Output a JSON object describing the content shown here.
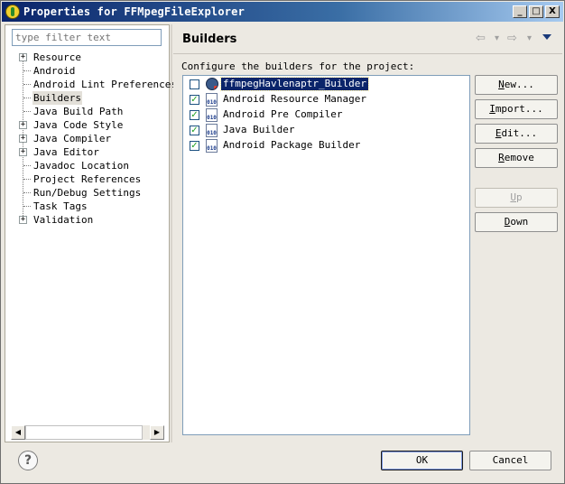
{
  "window": {
    "title": "Properties for FFMpegFileExplorer",
    "controls": {
      "minimize": "_",
      "maximize": "□",
      "close": "X"
    }
  },
  "sidebar": {
    "filter_placeholder": "type filter text",
    "items": [
      {
        "label": "Resource",
        "expandable": true
      },
      {
        "label": "Android",
        "expandable": false
      },
      {
        "label": "Android Lint Preferences",
        "expandable": false
      },
      {
        "label": "Builders",
        "expandable": false,
        "selected": true
      },
      {
        "label": "Java Build Path",
        "expandable": false
      },
      {
        "label": "Java Code Style",
        "expandable": true
      },
      {
        "label": "Java Compiler",
        "expandable": true
      },
      {
        "label": "Java Editor",
        "expandable": true
      },
      {
        "label": "Javadoc Location",
        "expandable": false
      },
      {
        "label": "Project References",
        "expandable": false
      },
      {
        "label": "Run/Debug Settings",
        "expandable": false
      },
      {
        "label": "Task Tags",
        "expandable": false
      },
      {
        "label": "Validation",
        "expandable": true
      }
    ],
    "scroll_left": "◀",
    "scroll_right": "▶"
  },
  "page": {
    "title": "Builders",
    "nav": {
      "back": "⇦",
      "back_menu": "▾",
      "forward": "⇨",
      "forward_menu": "▾"
    },
    "description": "Configure the builders for the project:",
    "builders": [
      {
        "label": "ffmpegHavlenaptr_Builder",
        "checked": false,
        "selected": true,
        "icon": "external-tool-icon",
        "icon_text": ""
      },
      {
        "label": "Android Resource Manager",
        "checked": true,
        "selected": false,
        "icon": "builder-file-icon",
        "icon_text": "010"
      },
      {
        "label": "Android Pre Compiler",
        "checked": true,
        "selected": false,
        "icon": "builder-file-icon",
        "icon_text": "010"
      },
      {
        "label": "Java Builder",
        "checked": true,
        "selected": false,
        "icon": "builder-file-icon",
        "icon_text": "010"
      },
      {
        "label": "Android Package Builder",
        "checked": true,
        "selected": false,
        "icon": "builder-file-icon",
        "icon_text": "010"
      }
    ],
    "check_mark": "✓",
    "buttons": {
      "new": {
        "mnemonic": "N",
        "rest": "ew..."
      },
      "import": {
        "mnemonic": "I",
        "rest": "mport..."
      },
      "edit": {
        "mnemonic": "E",
        "rest": "dit..."
      },
      "remove": {
        "mnemonic": "R",
        "rest": "emove"
      },
      "up": {
        "mnemonic": "U",
        "rest": "p"
      },
      "down": {
        "mnemonic": "D",
        "rest": "own"
      }
    }
  },
  "footer": {
    "help": "?",
    "ok_label": "OK",
    "cancel_label": "Cancel"
  }
}
